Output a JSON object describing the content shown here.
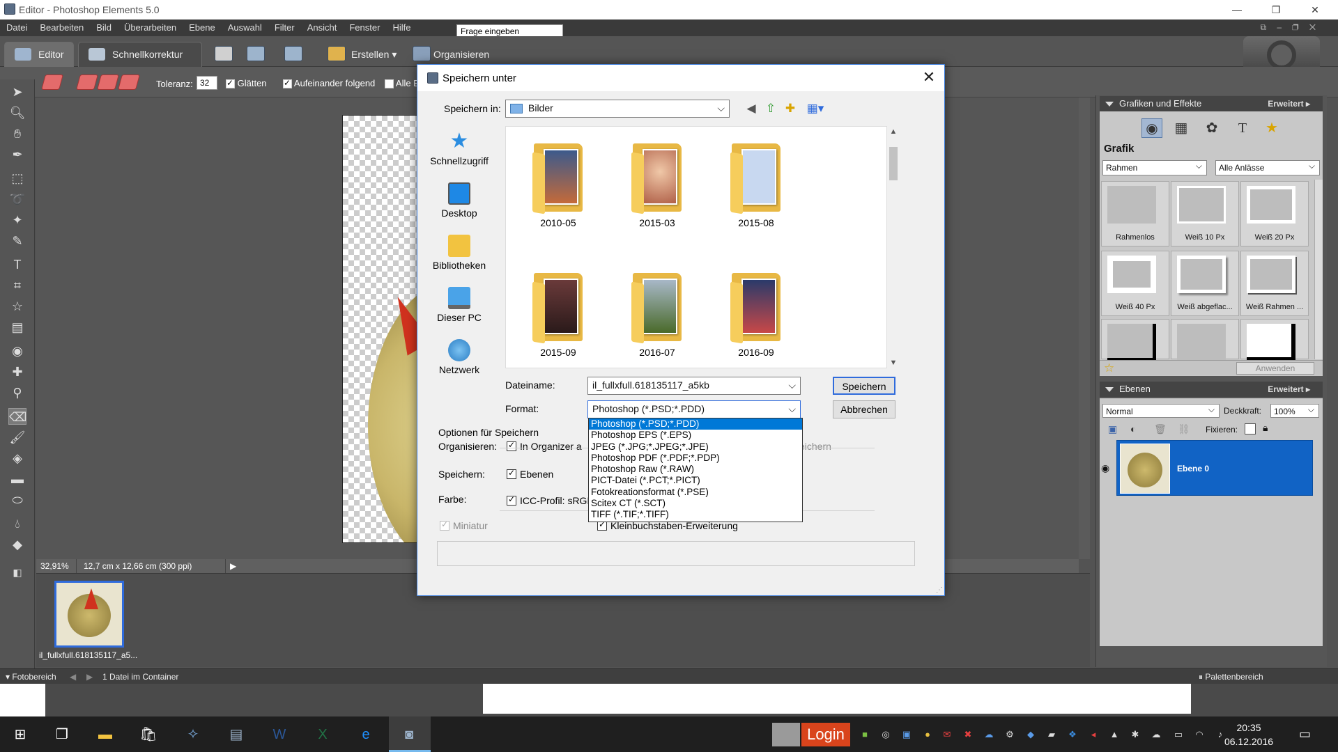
{
  "window": {
    "title": "Editor - Photoshop Elements 5.0",
    "minimize": "—",
    "maximize": "❐",
    "close": "✕"
  },
  "menu": [
    "Datei",
    "Bearbeiten",
    "Bild",
    "Überarbeiten",
    "Ebene",
    "Auswahl",
    "Filter",
    "Ansicht",
    "Fenster",
    "Hilfe"
  ],
  "ask_field": "Frage eingeben",
  "modes": {
    "editor": "Editor",
    "quick": "Schnellkorrektur",
    "create": "Erstellen",
    "organize": "Organisieren"
  },
  "options": {
    "tolerance_label": "Toleranz:",
    "tolerance_value": "32",
    "smooth": "Glätten",
    "contiguous": "Aufeinander folgend",
    "all_layers": "Alle E"
  },
  "status": {
    "zoom": "32,91%",
    "size": "12,7 cm x 12,66 cm (300 ppi)"
  },
  "photobin": {
    "thumb_label": "il_fullxfull.618135117_a5...",
    "footer_left": "Fotobereich",
    "footer_count": "1 Datei im Container",
    "footer_right": "Palettenbereich"
  },
  "effects": {
    "header": "Grafiken und Effekte",
    "more": "Erweitert ▸",
    "section": "Grafik",
    "filter1": "Rahmen",
    "filter2": "Alle Anlässe",
    "items": [
      "Rahmenlos",
      "Weiß 10 Px",
      "Weiß 20 Px",
      "Weiß 40 Px",
      "Weiß abgeflac...",
      "Weiß Rahmen ...",
      "",
      ""
    ],
    "apply": "Anwenden"
  },
  "layers": {
    "header": "Ebenen",
    "more": "Erweitert ▸",
    "blend": "Normal",
    "opacity_label": "Deckkraft:",
    "opacity_value": "100%",
    "lock_label": "Fixieren:",
    "layer_name": "Ebene 0"
  },
  "dialog": {
    "title": "Speichern unter",
    "save_in_label": "Speichern in:",
    "save_in_value": "Bilder",
    "places": [
      "Schnellzugriff",
      "Desktop",
      "Bibliotheken",
      "Dieser PC",
      "Netzwerk"
    ],
    "folders": [
      "2010-05",
      "2015-03",
      "2015-08",
      "2015-09",
      "2016-07",
      "2016-09"
    ],
    "filename_label": "Dateiname:",
    "filename_value": "il_fullxfull.618135117_a5kb",
    "format_label": "Format:",
    "format_value": "Photoshop (*.PSD;*.PDD)",
    "save_button": "Speichern",
    "cancel_button": "Abbrechen",
    "options_title": "Optionen für Speichern",
    "organize_label": "Organisieren:",
    "organize_check": "In Organizer a",
    "organize_trail": "eichern",
    "save_label": "Speichern:",
    "save_check": "Ebenen",
    "color_label": "Farbe:",
    "color_check": "ICC-Profil: sRGB",
    "thumbnail_check": "Miniatur",
    "lowercase_check": "Kleinbuchstaben-Erweiterung"
  },
  "format_options": [
    "Photoshop (*.PSD;*.PDD)",
    "Photoshop EPS (*.EPS)",
    "JPEG (*.JPG;*.JPEG;*.JPE)",
    "Photoshop PDF (*.PDF;*.PDP)",
    "Photoshop Raw (*.RAW)",
    "PICT-Datei (*.PCT;*.PICT)",
    "Fotokreationsformat (*.PSE)",
    "Scitex CT (*.SCT)",
    "TIFF (*.TIF;*.TIFF)"
  ],
  "taskbar": {
    "login": "Login",
    "time": "20:35",
    "date": "06.12.2016"
  },
  "colors": {
    "accent": "#0078d7",
    "selection": "#1163c5",
    "ps_dark": "#3a3a3a"
  }
}
